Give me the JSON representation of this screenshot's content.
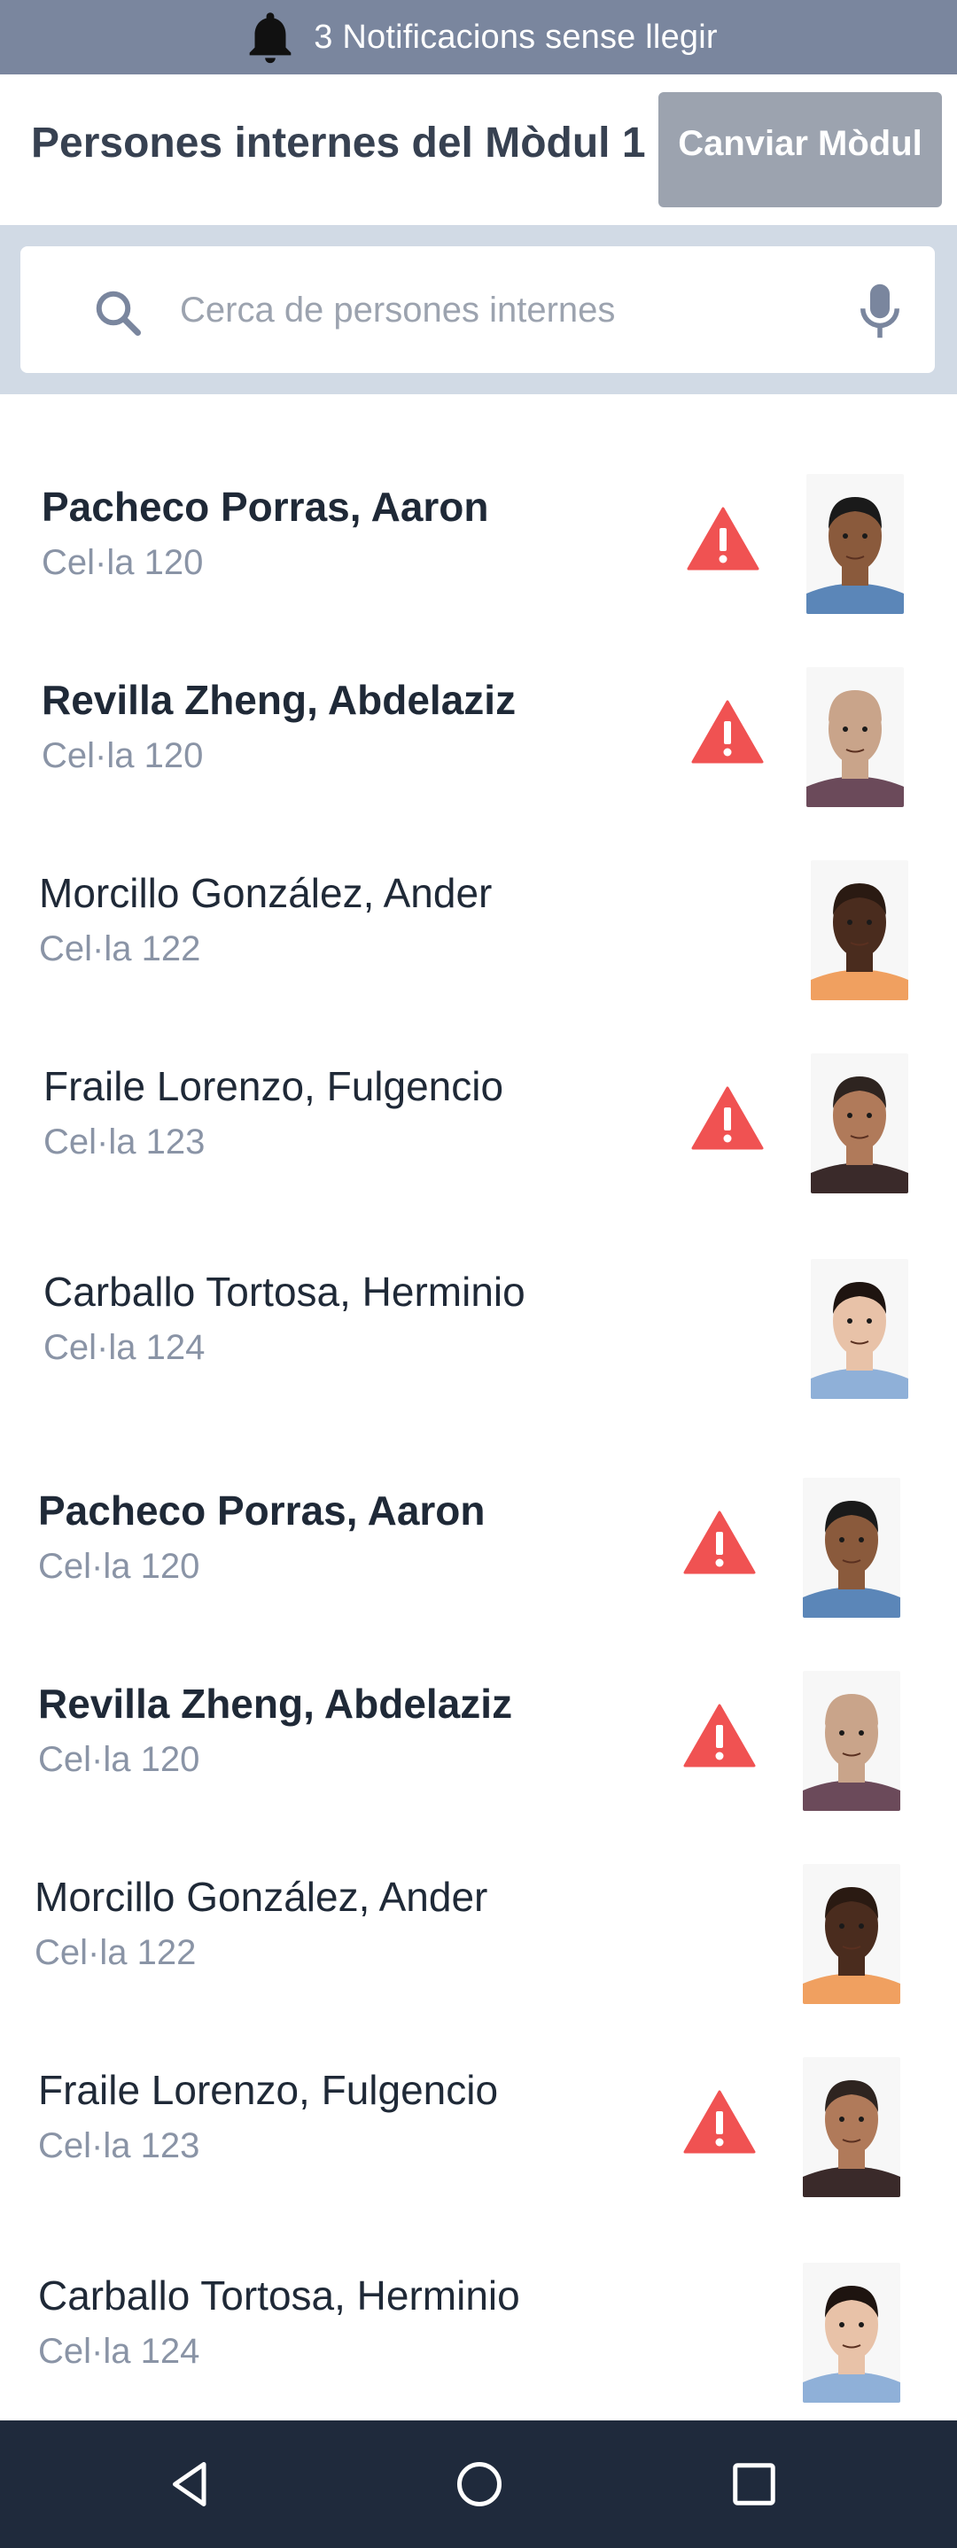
{
  "notifications": {
    "text": "3 Notificacions sense llegir",
    "icon": "bell-icon"
  },
  "header": {
    "title": "Persones internes del Mòdul 1",
    "switch_label": "Canviar Mòdul"
  },
  "search": {
    "placeholder": "Cerca de persones internes",
    "value": "",
    "icons": [
      "search-icon",
      "microphone-icon"
    ]
  },
  "colors": {
    "notif_bar": "#7a869e",
    "search_strip": "#d1dae5",
    "button": "#9ca3af",
    "alert": "#f05252",
    "navbar": "#1f2a3c"
  },
  "inmates": [
    {
      "name": "Pacheco Porras, Aaron",
      "cell": "Cel·la 120",
      "alert": true,
      "bold": true,
      "skin": "#8a5a3c",
      "hair": "#1a1a1a",
      "shirt": "#5b86b8"
    },
    {
      "name": "Revilla Zheng, Abdelaziz",
      "cell": "Cel·la 120",
      "alert": true,
      "bold": true,
      "skin": "#c9a48a",
      "hair": "#c9a48a",
      "shirt": "#6b4a5a"
    },
    {
      "name": "Morcillo González, Ander",
      "cell": "Cel·la 122",
      "alert": false,
      "bold": false,
      "skin": "#4a2c1e",
      "hair": "#2a1a12",
      "shirt": "#f0a060"
    },
    {
      "name": "Fraile Lorenzo, Fulgencio",
      "cell": "Cel·la 123",
      "alert": true,
      "bold": false,
      "skin": "#b07a5a",
      "hair": "#2e2420",
      "shirt": "#3a2a2a"
    },
    {
      "name": "Carballo Tortosa, Herminio",
      "cell": "Cel·la 124",
      "alert": false,
      "bold": false,
      "skin": "#e8c2a8",
      "hair": "#1e1410",
      "shirt": "#8fb0d8"
    },
    {
      "name": "Pacheco Porras, Aaron",
      "cell": "Cel·la 120",
      "alert": true,
      "bold": true,
      "skin": "#8a5a3c",
      "hair": "#1a1a1a",
      "shirt": "#5b86b8"
    },
    {
      "name": "Revilla Zheng, Abdelaziz",
      "cell": "Cel·la 120",
      "alert": true,
      "bold": true,
      "skin": "#c9a48a",
      "hair": "#c9a48a",
      "shirt": "#6b4a5a"
    },
    {
      "name": "Morcillo González, Ander",
      "cell": "Cel·la 122",
      "alert": false,
      "bold": false,
      "skin": "#4a2c1e",
      "hair": "#2a1a12",
      "shirt": "#f0a060"
    },
    {
      "name": "Fraile Lorenzo, Fulgencio",
      "cell": "Cel·la 123",
      "alert": true,
      "bold": false,
      "skin": "#b07a5a",
      "hair": "#2e2420",
      "shirt": "#3a2a2a"
    },
    {
      "name": "Carballo Tortosa, Herminio",
      "cell": "Cel·la 124",
      "alert": false,
      "bold": false,
      "skin": "#e8c2a8",
      "hair": "#1e1410",
      "shirt": "#8fb0d8"
    }
  ],
  "navbar": {
    "buttons": [
      "back-icon",
      "home-icon",
      "recents-icon"
    ]
  }
}
